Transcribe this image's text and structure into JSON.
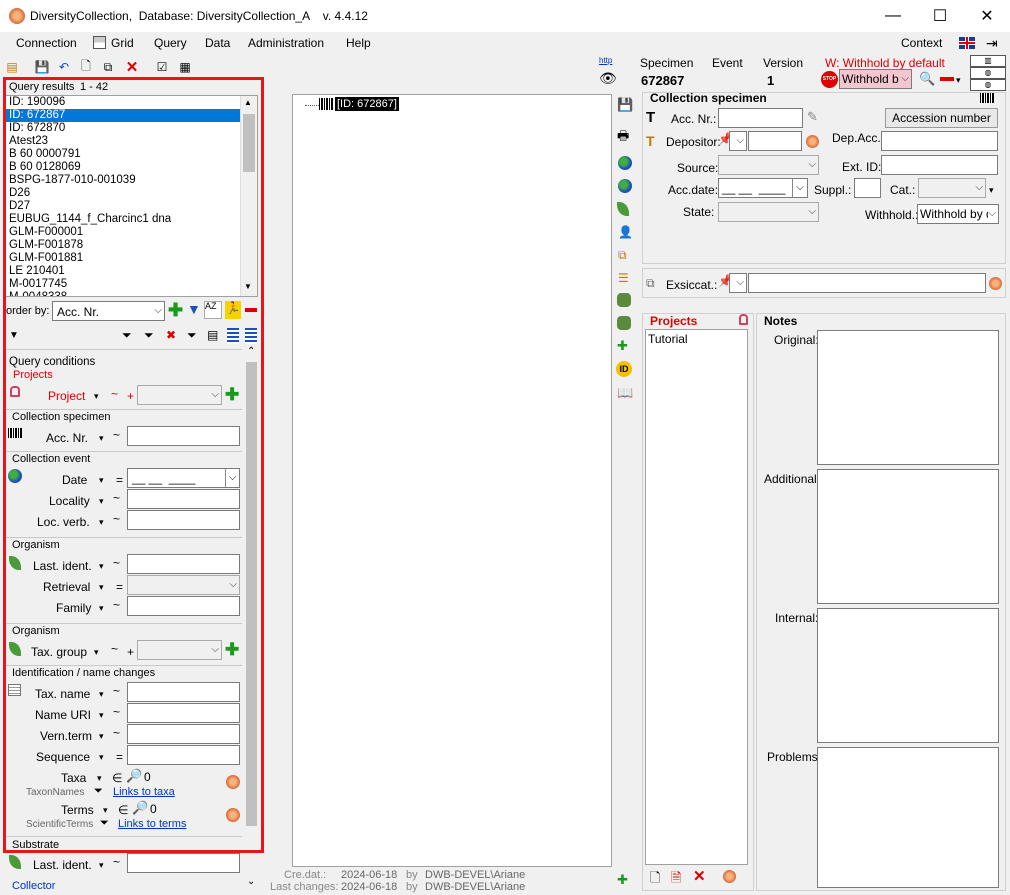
{
  "window": {
    "title": "DiversityCollection,  Database: DiversityCollection_A    v. 4.4.12",
    "minimize": "—",
    "maximize": "☐",
    "close": "✕"
  },
  "menu": {
    "connection": "Connection",
    "grid": "Grid",
    "query": "Query",
    "data": "Data",
    "administration": "Administration",
    "help": "Help",
    "context": "Context"
  },
  "query": {
    "results_label": "Query results",
    "results_range": "1 - 42",
    "results": [
      "ID: 190096",
      "ID: 672867",
      "ID: 672870",
      "Atest23",
      "B 60 0000791",
      "B 60 0128069",
      "BSPG-1877-010-001039",
      "D26",
      "D27",
      "EUBUG_1144_f_Charcinc1 dna",
      "GLM-F000001",
      "GLM-F001878",
      "GLM-F001881",
      "LE 210401",
      "M-0017745",
      "M-0048338"
    ],
    "selected_index": 1,
    "order_by_label": "order by:",
    "order_by_value": "Acc. Nr.",
    "conditions_label": "Query conditions",
    "projects_label": "Projects",
    "project_label": "Project",
    "collection_specimen_label": "Collection specimen",
    "acc_nr_label": "Acc. Nr.",
    "collection_event_label": "Collection event",
    "date_label": "Date",
    "date_value": "__ __  ____",
    "locality_label": "Locality",
    "loc_verb_label": "Loc. verb.",
    "organism_label": "Organism",
    "last_ident_label": "Last. ident.",
    "retrieval_label": "Retrieval",
    "family_label": "Family",
    "organism2_label": "Organism",
    "tax_group_label": "Tax. group",
    "identification_label": "Identification / name changes",
    "tax_name_label": "Tax. name",
    "name_uri_label": "Name URI",
    "vern_term_label": "Vern.term",
    "sequence_label": "Sequence",
    "taxa_label": "Taxa",
    "taxa_count": "0",
    "taxon_names_label": "TaxonNames",
    "links_to_taxa": "Links to taxa",
    "terms_label": "Terms",
    "terms_count": "0",
    "scientific_terms_label": "ScientificTerms",
    "links_to_terms": "Links to terms",
    "substrate_label": "Substrate",
    "substrate_last_ident_label": "Last. ident.",
    "collector_label": "Collector",
    "op_tilde": "~",
    "op_eq": "=",
    "op_plus": "+",
    "op_in": "∈"
  },
  "tree": {
    "node": "[ID: 672867]"
  },
  "footer": {
    "cre_label": "Cre.dat.:",
    "cre_date": "2024-06-18",
    "by": "by",
    "cre_user": "DWB-DEVEL\\Ariane",
    "last_label": "Last changes:",
    "last_date": "2024-06-18",
    "last_user": "DWB-DEVEL\\Ariane"
  },
  "header": {
    "http": "http",
    "specimen_label": "Specimen",
    "specimen_value": "672867",
    "event_label": "Event",
    "version_label": "Version",
    "version_value": "1",
    "withhold_label": "W: Withhold by default",
    "withhold_value": "Withhold b"
  },
  "specimen": {
    "section_title": "Collection specimen",
    "acc_nr_label": "Acc. Nr.:",
    "accession_button": "Accession number",
    "depositor_label": "Depositor:",
    "dep_acc_label": "Dep.Acc.",
    "source_label": "Source:",
    "ext_id_label": "Ext. ID:",
    "acc_date_label": "Acc.date:",
    "acc_date_value": "__ __  ____",
    "suppl_label": "Suppl.:",
    "cat_label": "Cat.:",
    "state_label": "State:",
    "withhold_label": "Withhold.:",
    "withhold_value": "Withhold by d",
    "exsiccat_label": "Exsiccat.:"
  },
  "projects": {
    "title": "Projects",
    "items": [
      "Tutorial"
    ]
  },
  "notes": {
    "title": "Notes",
    "original": "Original:",
    "additional": "Additional:",
    "internal": "Internal:",
    "problems": "Problems:"
  }
}
